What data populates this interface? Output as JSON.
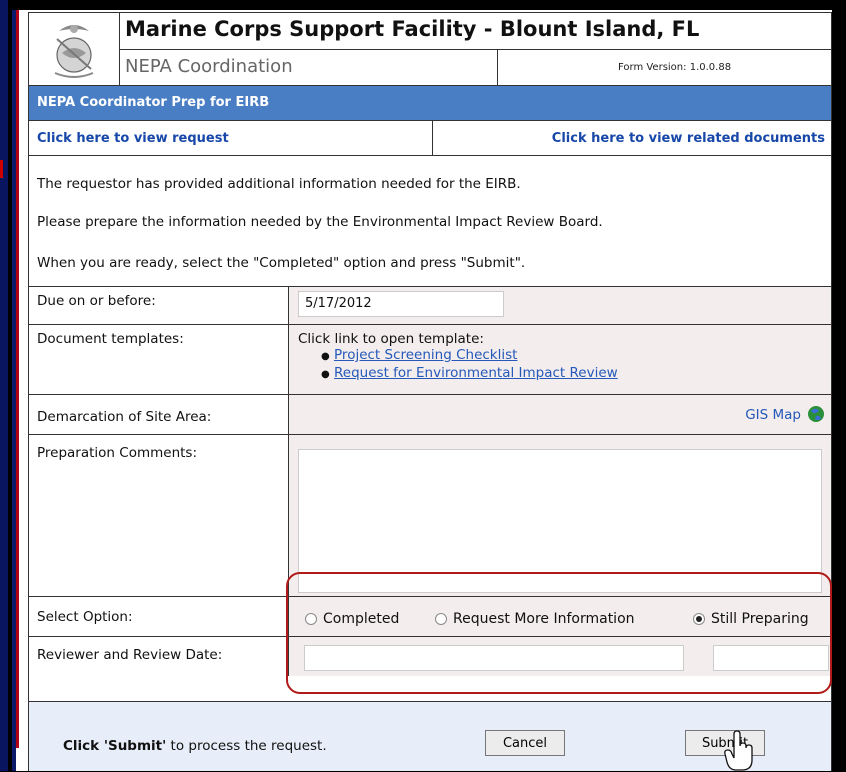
{
  "header": {
    "title": "Marine Corps Support Facility - Blount Island, FL",
    "subtitle": "NEPA Coordination",
    "form_version_label": "Form Version:",
    "form_version": "1.0.0.88"
  },
  "section": {
    "title": "NEPA Coordinator Prep for EIRB"
  },
  "links": {
    "view_request": "Click here to view request",
    "view_documents": "Click here to view related documents"
  },
  "info": [
    "The requestor has provided additional information needed for the EIRB.",
    "Please prepare the information needed by the Environmental Impact Review Board.",
    "When you are ready, select the \"Completed\" option and press \"Submit\"."
  ],
  "fields": {
    "due": {
      "label": "Due on or before:",
      "value": "5/17/2012"
    },
    "templates": {
      "label": "Document templates:",
      "intro": "Click link to open template:",
      "items": [
        "Project Screening Checklist",
        "Request for Environmental Impact Review"
      ]
    },
    "demarcation": {
      "label": "Demarcation of Site Area:",
      "link": "GIS Map"
    },
    "comments": {
      "label": "Preparation Comments:",
      "value": ""
    },
    "select_option": {
      "label": "Select Option:",
      "options": [
        "Completed",
        "Request More Information",
        "Still Preparing"
      ],
      "selected": "Still Preparing"
    },
    "reviewer": {
      "label": "Reviewer and Review Date:",
      "name": "",
      "date": ""
    }
  },
  "footer": {
    "submit_prefix": "Click 'Submit'",
    "submit_suffix": " to process the request.",
    "cancel": "Cancel",
    "submit": "Submit"
  }
}
